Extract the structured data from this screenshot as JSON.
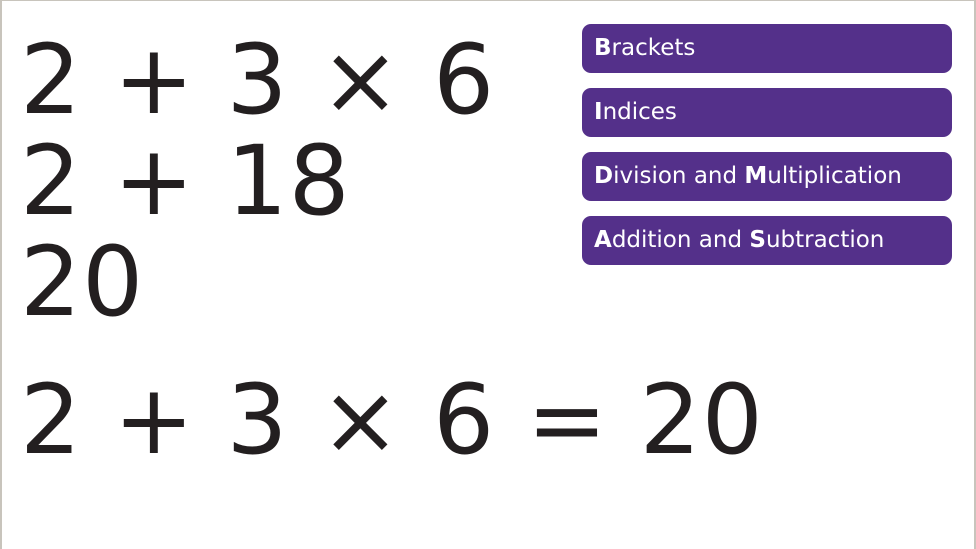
{
  "working": {
    "lines": [
      "2 + 3 × 6",
      "2 + 18",
      "20"
    ],
    "result": "2 + 3 × 6 = 20"
  },
  "bidmas": {
    "accent_color": "#54308a",
    "items": [
      {
        "parts": [
          {
            "b": "B"
          },
          {
            "t": "rackets"
          }
        ]
      },
      {
        "parts": [
          {
            "b": "I"
          },
          {
            "t": "ndices"
          }
        ]
      },
      {
        "parts": [
          {
            "b": "D"
          },
          {
            "t": "ivision and "
          },
          {
            "b": "M"
          },
          {
            "t": "ultiplication"
          }
        ]
      },
      {
        "parts": [
          {
            "b": "A"
          },
          {
            "t": "ddition and "
          },
          {
            "b": "S"
          },
          {
            "t": "ubtraction"
          }
        ]
      }
    ]
  }
}
